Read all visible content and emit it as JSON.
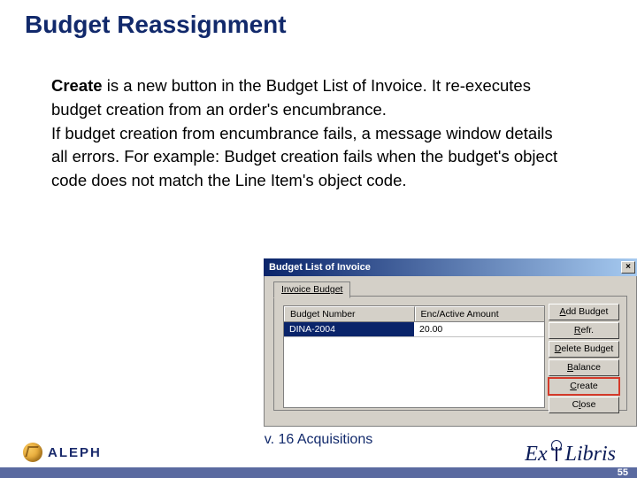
{
  "title": "Budget Reassignment",
  "body": {
    "create_word": "Create",
    "sentence1_rest": " is a new button in the Budget List of Invoice. It re-executes budget creation from an order's encumbrance.",
    "sentence2": "If budget creation from encumbrance fails, a message window details all errors. For example: Budget creation fails when the budget's object code does not match the Line Item's object code."
  },
  "window": {
    "titlebar": "Budget List of Invoice",
    "close_glyph": "×",
    "tab_label": "Invoice Budget",
    "columns": {
      "c1": "Budget Number",
      "c2": "Enc/Active Amount"
    },
    "row1": {
      "budget": "DINA-2004",
      "amount": "20.00"
    },
    "buttons": {
      "add": "Add Budget",
      "refr": "Refr.",
      "delete": "Delete Budget",
      "balance": "Balance",
      "create": "Create",
      "close": "Close"
    },
    "button_underline_chars": {
      "add": "A",
      "refr": "R",
      "delete": "D",
      "balance": "B",
      "create": "C",
      "close": "l"
    }
  },
  "footer": "v. 16 Acquisitions",
  "slide_number": "55",
  "logos": {
    "aleph": "ALEPH",
    "exlibris_prefix": "E",
    "exlibris_x": "x",
    "exlibris_suffix": "Libris"
  }
}
